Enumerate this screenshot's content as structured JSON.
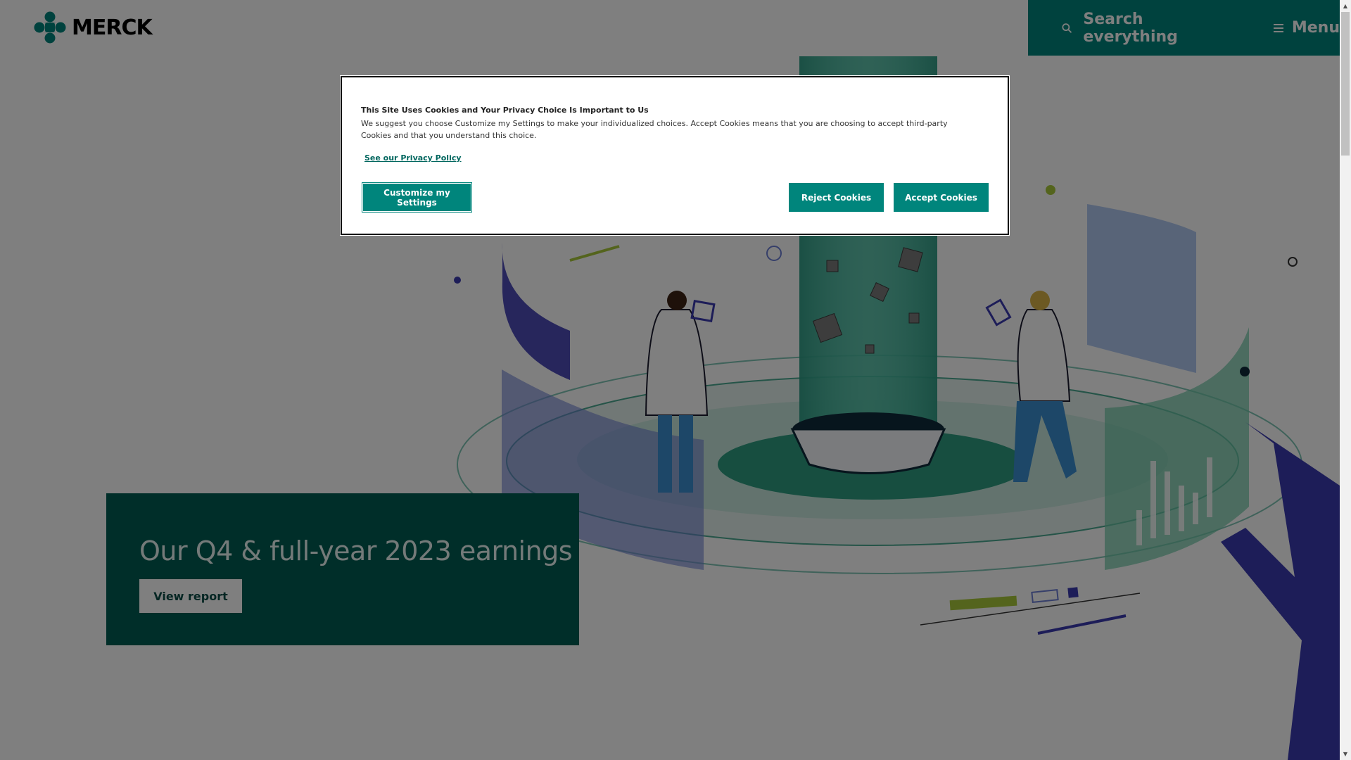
{
  "brand": {
    "name": "MERCK",
    "color": "#00857c"
  },
  "header": {
    "search_label": "Search everything",
    "menu_label": "Menu"
  },
  "promo": {
    "title": "Our Q4 & full-year 2023 earnings",
    "button_label": "View report"
  },
  "cookie_dialog": {
    "title": "This Site Uses Cookies and Your Privacy Choice Is Important to Us",
    "body": "We suggest you choose Customize my Settings to make your individualized choices. Accept Cookies means that you are choosing to accept third-party Cookies and that you understand this choice.",
    "privacy_link": "See our Privacy Policy",
    "customize_label": "Customize my Settings",
    "reject_label": "Reject Cookies",
    "accept_label": "Accept Cookies"
  },
  "icons": [
    "merck-logo-icon",
    "search-icon",
    "hamburger-menu-icon",
    "scroll-up-icon",
    "scroll-down-icon"
  ]
}
